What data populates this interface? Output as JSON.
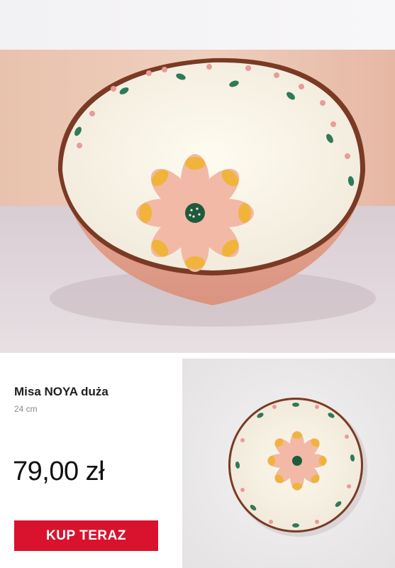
{
  "product": {
    "name": "Misa NOYA duża",
    "size": "24 cm",
    "price": "79,00 zł",
    "buy_button_label": "KUP TERAZ"
  },
  "colors": {
    "accent": "#d9122e",
    "bowl_exterior": "#e8a898",
    "bowl_rim": "#7a3a24",
    "glaze": "#fbf6e8"
  },
  "images": {
    "main_photo": "bowl-front-photo",
    "thumbnail_photo": "bowl-top-view-photo"
  }
}
